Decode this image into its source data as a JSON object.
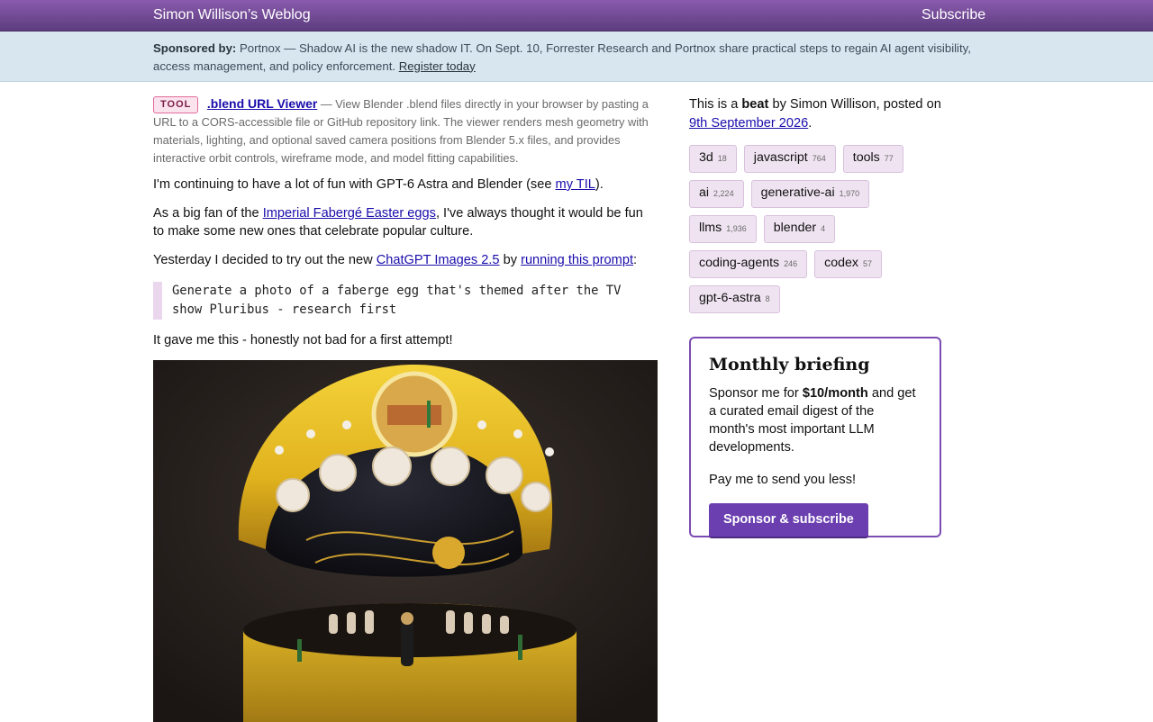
{
  "header": {
    "site_title": "Simon Willison’s Weblog",
    "subscribe_label": "Subscribe"
  },
  "sponsor": {
    "lead": "Sponsored by:",
    "text": "Portnox — Shadow AI is the new shadow IT. On Sept. 10, Forrester Research and Portnox share practical steps to regain AI agent visibility, access management, and policy enforcement.",
    "link_label": "Register today"
  },
  "tool": {
    "badge": "TOOL",
    "title": ".blend URL Viewer",
    "description": "— View Blender .blend files directly in your browser by pasting a URL to a CORS-accessible file or GitHub repository link. The viewer renders mesh geometry with materials, lighting, and optional saved camera positions from Blender 5.x files, and provides interactive orbit controls, wireframe mode, and model fitting capabilities."
  },
  "post": {
    "p1_before": "I'm continuing to have a lot of fun with GPT-6 Astra and Blender (see ",
    "p1_link": "my TIL",
    "p1_after": ").",
    "p2_before": "As a big fan of the ",
    "p2_link": "Imperial Fabergé Easter eggs",
    "p2_after": ", I've always thought it would be fun to make some new ones that celebrate popular culture.",
    "p3_before": "Yesterday I decided to try out the new ",
    "p3_link1": "ChatGPT Images 2.5",
    "p3_mid": " by ",
    "p3_link2": "running this prompt",
    "p3_after": ":",
    "prompt": "Generate a photo of a faberge egg that's themed after the TV show Pluribus - research first",
    "p4": "It gave me this - honestly not bad for a first attempt!"
  },
  "sidebar": {
    "meta_prefix": "This is a ",
    "meta_beat": "beat",
    "meta_middle": " by Simon Willison, posted on",
    "meta_date": "9th September 2026",
    "meta_end": ".",
    "tags": [
      {
        "name": "3d",
        "count": "18"
      },
      {
        "name": "javascript",
        "count": "764"
      },
      {
        "name": "tools",
        "count": "77"
      },
      {
        "name": "ai",
        "count": "2,224"
      },
      {
        "name": "generative-ai",
        "count": "1,970"
      },
      {
        "name": "llms",
        "count": "1,936"
      },
      {
        "name": "blender",
        "count": "4"
      },
      {
        "name": "coding-agents",
        "count": "246"
      },
      {
        "name": "codex",
        "count": "57"
      },
      {
        "name": "gpt-6-astra",
        "count": "8"
      }
    ]
  },
  "briefing": {
    "title": "Monthly briefing",
    "text_before": "Sponsor me for ",
    "price": "$10/month",
    "text_after": " and get a curated email digest of the month's most important LLM developments.",
    "tagline": "Pay me to send you less!",
    "button_label": "Sponsor & subscribe"
  },
  "colors": {
    "header_bg": "#6b4690",
    "sponsor_bg": "#d8e6f0",
    "accent": "#6b3fb0",
    "tag_bg": "#efe3f1"
  }
}
